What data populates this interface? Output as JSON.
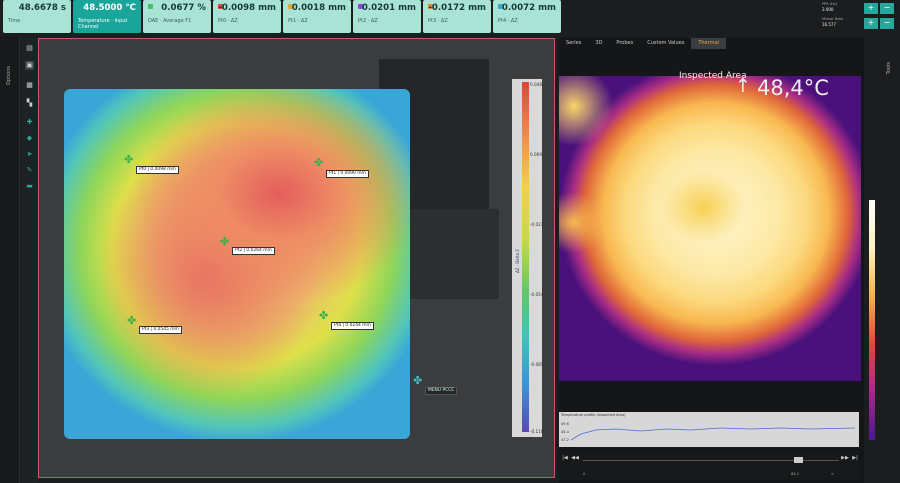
{
  "header_tiles": [
    {
      "value": "48.6678 s",
      "label": "Time",
      "color": ""
    },
    {
      "value": "48.5000 °C",
      "label": "Temperature · Input Channel",
      "color": "",
      "active": true
    },
    {
      "value": "0.0677 %",
      "label": "DAE · Average F1",
      "color": "#3cc46a"
    },
    {
      "value": "-0.0098 mm",
      "label": "Pt0 · ΔZ",
      "color": "#e0463a"
    },
    {
      "value": "0.0018 mm",
      "label": "Pt1 · ΔZ",
      "color": "#e6a53a"
    },
    {
      "value": "0.0201 mm",
      "label": "Pt2 · ΔZ",
      "color": "#8a4bd8"
    },
    {
      "value": "-0.0172 mm",
      "label": "Pt3 · ΔZ",
      "color": "#e08a2e"
    },
    {
      "value": "0.0072 mm",
      "label": "Pt4 · ΔZ",
      "color": "#3aa8c6"
    }
  ],
  "top_right": {
    "label1": "FPS (Hz)",
    "value1": "3.000",
    "label2": "Mvisor Rate",
    "value2": "16.577",
    "plus": "+",
    "minus": "−"
  },
  "left_bar": {
    "label": "Options"
  },
  "right_bar": {
    "label": "Tools"
  },
  "probes": [
    {
      "label": "Pt0 | 0.0098 mm"
    },
    {
      "label": "Pt1 | 0.0090 mm"
    },
    {
      "label": "Pt2 | 0.0264 mm"
    },
    {
      "label": "Pt3 | 0.0545 mm"
    },
    {
      "label": "Pt4 | 0.0244 mm"
    }
  ],
  "extra_label": "MENU PCCE",
  "colorbar": {
    "ticks": [
      "0.048",
      "0.009",
      "-0.023",
      "-0.054",
      "-0.085",
      "-0.116"
    ],
    "title": "ΔZ · Delta Z"
  },
  "tabs": [
    "Series",
    "3D",
    "Probes",
    "Custom Values",
    "Thermal"
  ],
  "active_tab": "Thermal",
  "thermal": {
    "area_label": "Inspected Area",
    "arrow": "↑",
    "temperature": "48,4°C"
  },
  "graph": {
    "title": "Temperature profile (Inspected Area)",
    "y_ticks": [
      "49.6",
      "48.4",
      "47.2"
    ]
  },
  "timeline": {
    "ticks": [
      "0",
      "84.2",
      "∞"
    ],
    "buttons": [
      "|◀",
      "◀◀",
      "▶▶",
      "▶|"
    ]
  }
}
